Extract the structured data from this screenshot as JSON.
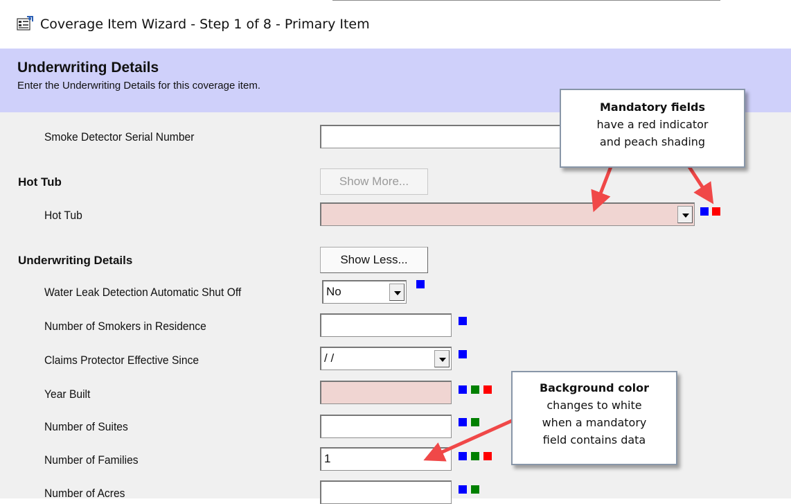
{
  "window": {
    "title": "Coverage Item Wizard - Step 1 of 8 - Primary Item",
    "icon": "wizard-window-icon"
  },
  "header": {
    "title": "Underwriting Details",
    "subtitle": "Enter the Underwriting Details for this coverage item."
  },
  "colors": {
    "header_band": "#cfd0fa",
    "mandatory_shading": "#f0d5d2",
    "indicator_blue": "#0000ff",
    "indicator_green": "#008000",
    "indicator_red": "#ff0000",
    "callout_arrow": "#f04848"
  },
  "form": {
    "smoke_detector_label": "Smoke Detector Serial Number",
    "smoke_detector_value": "",
    "hot_tub_section": "Hot Tub",
    "show_more": "Show More...",
    "hot_tub_label": "Hot Tub",
    "hot_tub_value": "",
    "uw_section": "Underwriting Details",
    "show_less": "Show Less...",
    "water_leak_label": "Water Leak Detection Automatic Shut Off",
    "water_leak_value": "No",
    "smokers_label": "Number of Smokers in Residence",
    "smokers_value": "",
    "claims_label": "Claims Protector Effective Since",
    "claims_value": "/ /",
    "year_built_label": "Year Built",
    "year_built_value": "",
    "suites_label": "Number of Suites",
    "suites_value": "",
    "families_label": "Number of Families",
    "families_value": "1",
    "acres_label": "Number of Acres",
    "acres_value": ""
  },
  "callouts": {
    "mandatory": {
      "title": "Mandatory fields",
      "line1": "have a red indicator",
      "line2": "and peach shading"
    },
    "background": {
      "title": "Background color",
      "line1": "changes to white",
      "line2": "when a mandatory",
      "line3": "field contains data"
    }
  }
}
